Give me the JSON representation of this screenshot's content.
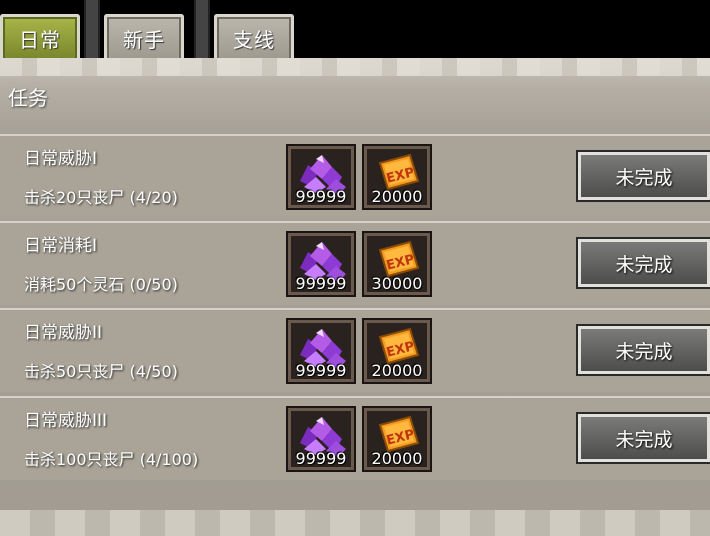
{
  "tabs": [
    {
      "label": "日常",
      "active": true
    },
    {
      "label": "新手",
      "active": false
    },
    {
      "label": "支线",
      "active": false
    }
  ],
  "section_title": "任务",
  "quests": [
    {
      "name": "日常威胁I",
      "desc": "击杀20只丧尸 (4/20)",
      "gem_count": "99999",
      "exp_count": "20000",
      "status": "未完成"
    },
    {
      "name": "日常消耗I",
      "desc": "消耗50个灵石 (0/50)",
      "gem_count": "99999",
      "exp_count": "30000",
      "status": "未完成"
    },
    {
      "name": "日常威胁II",
      "desc": "击杀50只丧尸 (4/50)",
      "gem_count": "99999",
      "exp_count": "20000",
      "status": "未完成"
    },
    {
      "name": "日常威胁III",
      "desc": "击杀100只丧尸 (4/100)",
      "gem_count": "99999",
      "exp_count": "20000",
      "status": "未完成"
    }
  ],
  "icons": {
    "gem": "purple-gem-icon",
    "exp": "exp-ticket-icon"
  },
  "colors": {
    "tab_active": "#8f9c38",
    "tab_inactive": "#aaa69c",
    "button": "#5e5e5c",
    "gem": "#9a3fd6",
    "exp": "#f08a1c"
  }
}
